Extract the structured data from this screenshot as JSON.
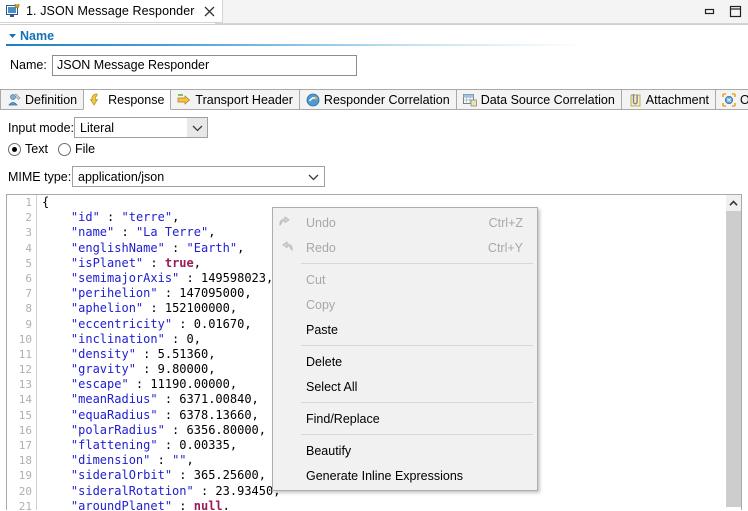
{
  "window": {
    "doc_tab": {
      "label": "1. JSON Message Responder",
      "icon": "editor-icon",
      "close": "✕"
    },
    "minimize_icon": "minimize-icon",
    "maximize_icon": "maximize-icon"
  },
  "section": {
    "title": "Name",
    "twisty": "▾"
  },
  "name_field": {
    "label": "Name:",
    "value": "JSON Message Responder",
    "placeholder": ""
  },
  "tabs": [
    {
      "label": "Definition",
      "icon": "definition-icon",
      "selected": false
    },
    {
      "label": "Response",
      "icon": "response-arrow-icon",
      "selected": true
    },
    {
      "label": "Transport Header",
      "icon": "transport-header-icon",
      "selected": false
    },
    {
      "label": "Responder Correlation",
      "icon": "responder-correlation-icon",
      "selected": false
    },
    {
      "label": "Data Source Correlation",
      "icon": "data-source-icon",
      "selected": false
    },
    {
      "label": "Attachment",
      "icon": "attachment-icon",
      "selected": false
    },
    {
      "label": "Options",
      "icon": "options-icon",
      "selected": false
    }
  ],
  "input_mode": {
    "label": "Input mode:",
    "value": "Literal",
    "options": [
      "Literal"
    ]
  },
  "source_radio": {
    "text": {
      "label": "Text",
      "selected": true
    },
    "file": {
      "label": "File",
      "selected": false
    }
  },
  "mime": {
    "label": "MIME type:",
    "value": "application/json",
    "options": [
      "application/json"
    ]
  },
  "editor": {
    "line_numbers": [
      "1",
      "2",
      "3",
      "4",
      "5",
      "6",
      "7",
      "8",
      "9",
      "10",
      "11",
      "12",
      "13",
      "14",
      "15",
      "16",
      "17",
      "18",
      "19",
      "20",
      "21"
    ],
    "lines": [
      [
        {
          "t": "pun",
          "v": "{"
        }
      ],
      [
        {
          "t": "pun",
          "v": "    "
        },
        {
          "t": "key",
          "v": "\"id\""
        },
        {
          "t": "pun",
          "v": " : "
        },
        {
          "t": "str",
          "v": "\"terre\""
        },
        {
          "t": "pun",
          "v": ","
        }
      ],
      [
        {
          "t": "pun",
          "v": "    "
        },
        {
          "t": "key",
          "v": "\"name\""
        },
        {
          "t": "pun",
          "v": " : "
        },
        {
          "t": "str",
          "v": "\"La Terre\""
        },
        {
          "t": "pun",
          "v": ","
        }
      ],
      [
        {
          "t": "pun",
          "v": "    "
        },
        {
          "t": "key",
          "v": "\"englishName\""
        },
        {
          "t": "pun",
          "v": " : "
        },
        {
          "t": "str",
          "v": "\"Earth\""
        },
        {
          "t": "pun",
          "v": ","
        }
      ],
      [
        {
          "t": "pun",
          "v": "    "
        },
        {
          "t": "key",
          "v": "\"isPlanet\""
        },
        {
          "t": "pun",
          "v": " : "
        },
        {
          "t": "lit",
          "v": "true"
        },
        {
          "t": "pun",
          "v": ","
        }
      ],
      [
        {
          "t": "pun",
          "v": "    "
        },
        {
          "t": "key",
          "v": "\"semimajorAxis\""
        },
        {
          "t": "pun",
          "v": " : "
        },
        {
          "t": "num",
          "v": "149598023"
        },
        {
          "t": "pun",
          "v": ","
        }
      ],
      [
        {
          "t": "pun",
          "v": "    "
        },
        {
          "t": "key",
          "v": "\"perihelion\""
        },
        {
          "t": "pun",
          "v": " : "
        },
        {
          "t": "num",
          "v": "147095000"
        },
        {
          "t": "pun",
          "v": ","
        }
      ],
      [
        {
          "t": "pun",
          "v": "    "
        },
        {
          "t": "key",
          "v": "\"aphelion\""
        },
        {
          "t": "pun",
          "v": " : "
        },
        {
          "t": "num",
          "v": "152100000"
        },
        {
          "t": "pun",
          "v": ","
        }
      ],
      [
        {
          "t": "pun",
          "v": "    "
        },
        {
          "t": "key",
          "v": "\"eccentricity\""
        },
        {
          "t": "pun",
          "v": " : "
        },
        {
          "t": "num",
          "v": "0.01670"
        },
        {
          "t": "pun",
          "v": ","
        }
      ],
      [
        {
          "t": "pun",
          "v": "    "
        },
        {
          "t": "key",
          "v": "\"inclination\""
        },
        {
          "t": "pun",
          "v": " : "
        },
        {
          "t": "num",
          "v": "0"
        },
        {
          "t": "pun",
          "v": ","
        }
      ],
      [
        {
          "t": "pun",
          "v": "    "
        },
        {
          "t": "key",
          "v": "\"density\""
        },
        {
          "t": "pun",
          "v": " : "
        },
        {
          "t": "num",
          "v": "5.51360"
        },
        {
          "t": "pun",
          "v": ","
        }
      ],
      [
        {
          "t": "pun",
          "v": "    "
        },
        {
          "t": "key",
          "v": "\"gravity\""
        },
        {
          "t": "pun",
          "v": " : "
        },
        {
          "t": "num",
          "v": "9.80000"
        },
        {
          "t": "pun",
          "v": ","
        }
      ],
      [
        {
          "t": "pun",
          "v": "    "
        },
        {
          "t": "key",
          "v": "\"escape\""
        },
        {
          "t": "pun",
          "v": " : "
        },
        {
          "t": "num",
          "v": "11190.00000"
        },
        {
          "t": "pun",
          "v": ","
        }
      ],
      [
        {
          "t": "pun",
          "v": "    "
        },
        {
          "t": "key",
          "v": "\"meanRadius\""
        },
        {
          "t": "pun",
          "v": " : "
        },
        {
          "t": "num",
          "v": "6371.00840"
        },
        {
          "t": "pun",
          "v": ","
        }
      ],
      [
        {
          "t": "pun",
          "v": "    "
        },
        {
          "t": "key",
          "v": "\"equaRadius\""
        },
        {
          "t": "pun",
          "v": " : "
        },
        {
          "t": "num",
          "v": "6378.13660"
        },
        {
          "t": "pun",
          "v": ","
        }
      ],
      [
        {
          "t": "pun",
          "v": "    "
        },
        {
          "t": "key",
          "v": "\"polarRadius\""
        },
        {
          "t": "pun",
          "v": " : "
        },
        {
          "t": "num",
          "v": "6356.80000"
        },
        {
          "t": "pun",
          "v": ","
        }
      ],
      [
        {
          "t": "pun",
          "v": "    "
        },
        {
          "t": "key",
          "v": "\"flattening\""
        },
        {
          "t": "pun",
          "v": " : "
        },
        {
          "t": "num",
          "v": "0.00335"
        },
        {
          "t": "pun",
          "v": ","
        }
      ],
      [
        {
          "t": "pun",
          "v": "    "
        },
        {
          "t": "key",
          "v": "\"dimension\""
        },
        {
          "t": "pun",
          "v": " : "
        },
        {
          "t": "str",
          "v": "\"\""
        },
        {
          "t": "pun",
          "v": ","
        }
      ],
      [
        {
          "t": "pun",
          "v": "    "
        },
        {
          "t": "key",
          "v": "\"sideralOrbit\""
        },
        {
          "t": "pun",
          "v": " : "
        },
        {
          "t": "num",
          "v": "365.25600"
        },
        {
          "t": "pun",
          "v": ","
        }
      ],
      [
        {
          "t": "pun",
          "v": "    "
        },
        {
          "t": "key",
          "v": "\"sideralRotation\""
        },
        {
          "t": "pun",
          "v": " : "
        },
        {
          "t": "num",
          "v": "23.93450"
        },
        {
          "t": "pun",
          "v": ","
        }
      ],
      [
        {
          "t": "pun",
          "v": "    "
        },
        {
          "t": "key",
          "v": "\"aroundPlanet\""
        },
        {
          "t": "pun",
          "v": " : "
        },
        {
          "t": "lit",
          "v": "null"
        },
        {
          "t": "pun",
          "v": ","
        }
      ]
    ]
  },
  "context_menu": {
    "items": [
      {
        "kind": "item",
        "label": "Undo",
        "accel": "Ctrl+Z",
        "enabled": false,
        "icon": "undo-icon"
      },
      {
        "kind": "item",
        "label": "Redo",
        "accel": "Ctrl+Y",
        "enabled": false,
        "icon": "redo-icon"
      },
      {
        "kind": "separator"
      },
      {
        "kind": "item",
        "label": "Cut",
        "accel": "",
        "enabled": false,
        "icon": ""
      },
      {
        "kind": "item",
        "label": "Copy",
        "accel": "",
        "enabled": false,
        "icon": ""
      },
      {
        "kind": "item",
        "label": "Paste",
        "accel": "",
        "enabled": true,
        "icon": ""
      },
      {
        "kind": "separator"
      },
      {
        "kind": "item",
        "label": "Delete",
        "accel": "",
        "enabled": true,
        "icon": ""
      },
      {
        "kind": "item",
        "label": "Select All",
        "accel": "",
        "enabled": true,
        "icon": ""
      },
      {
        "kind": "separator"
      },
      {
        "kind": "item",
        "label": "Find/Replace",
        "accel": "",
        "enabled": true,
        "icon": ""
      },
      {
        "kind": "separator"
      },
      {
        "kind": "item",
        "label": "Beautify",
        "accel": "",
        "enabled": true,
        "icon": ""
      },
      {
        "kind": "item",
        "label": "Generate Inline Expressions",
        "accel": "",
        "enabled": true,
        "icon": ""
      }
    ]
  },
  "colors": {
    "accent_blue": "#1473b5",
    "json_key": "#2020d0",
    "json_literal": "#9b1b5a",
    "menu_bg": "#f1f1f1",
    "disabled_text": "#a8a8a8"
  }
}
